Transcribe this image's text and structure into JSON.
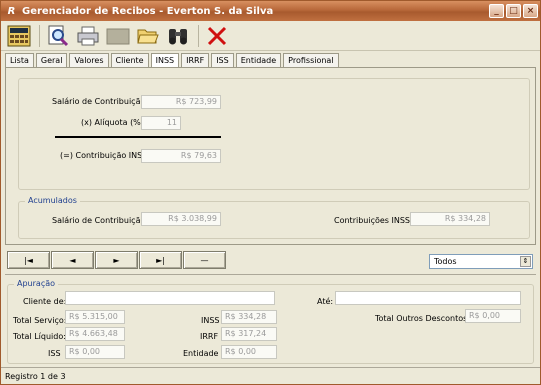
{
  "window": {
    "title": "Gerenciador de Recibos - Everton S. da Silva",
    "app_icon": "R",
    "controls": {
      "minimize": "_",
      "maximize": "□",
      "close": "×"
    }
  },
  "toolbar": {
    "icons": [
      "calculator-icon",
      "search-document-icon",
      "printer-icon",
      "blank-icon",
      "folder-open-icon",
      "binoculars-icon",
      "delete-x-icon"
    ]
  },
  "tabs": [
    "Lista",
    "Geral",
    "Valores",
    "Cliente",
    "INSS",
    "IRRF",
    "ISS",
    "Entidade",
    "Profissional"
  ],
  "active_tab": "INSS",
  "inss": {
    "salario_label": "Salário de Contribuição:",
    "salario_value": "R$ 723,99",
    "aliquota_label": "(x) Alíquota (%):",
    "aliquota_value": "11",
    "contribuicao_label": "(=) Contribuição INSS:",
    "contribuicao_value": "R$ 79,63"
  },
  "acumulados": {
    "title": "Acumulados",
    "salario_label": "Salário de Contribuição:",
    "salario_value": "R$ 3.038,99",
    "contribuicoes_label": "Contribuições INSS:",
    "contribuicoes_value": "R$ 334,28"
  },
  "navigation": {
    "first": "|◄",
    "prev": "◄",
    "next": "►",
    "last": "►|",
    "delete": "—"
  },
  "filter": {
    "selected": "Todos",
    "arrow": "⇕"
  },
  "apuracao": {
    "title": "Apuração",
    "cliente_label": "Cliente de:",
    "cliente_value": "",
    "ate_label": "Até:",
    "ate_value": "",
    "total_servico_label": "Total Serviço:",
    "total_servico_value": "R$ 5.315,00",
    "total_liquido_label": "Total Líquido:",
    "total_liquido_value": "R$ 4.663,48",
    "iss_label": "ISS",
    "iss_value": "R$ 0,00",
    "inss_label": "INSS",
    "inss_value": "R$ 334,28",
    "irrf_label": "IRRF",
    "irrf_value": "R$ 317,24",
    "entidade_label": "Entidade",
    "entidade_value": "R$ 0,00",
    "outros_label": "Total Outros Descontos:",
    "outros_value": "R$ 0,00"
  },
  "status": {
    "text": "Registro 1 de 3"
  }
}
